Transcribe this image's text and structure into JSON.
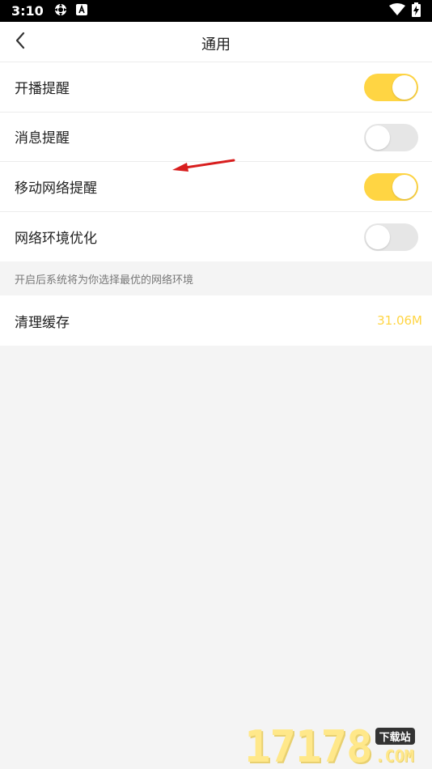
{
  "status_bar": {
    "time": "3:10",
    "icons": [
      "settings-gear-icon",
      "a-badge-icon",
      "wifi-icon",
      "battery-charging-icon"
    ]
  },
  "header": {
    "title": "通用",
    "back_icon": "chevron-left-icon"
  },
  "settings": [
    {
      "label": "开播提醒",
      "enabled": true
    },
    {
      "label": "消息提醒",
      "enabled": false
    },
    {
      "label": "移动网络提醒",
      "enabled": true
    },
    {
      "label": "网络环境优化",
      "enabled": false
    }
  ],
  "hint": "开启后系统将为你选择最优的网络环境",
  "cache": {
    "label": "清理缓存",
    "value": "31.06M"
  },
  "watermark": {
    "number": "17178",
    "badge": "下载站",
    "domain": ".COM"
  },
  "colors": {
    "accent": "#ffd543",
    "toggle_off": "#e6e6e6",
    "annotation_arrow": "#d81e1e"
  }
}
